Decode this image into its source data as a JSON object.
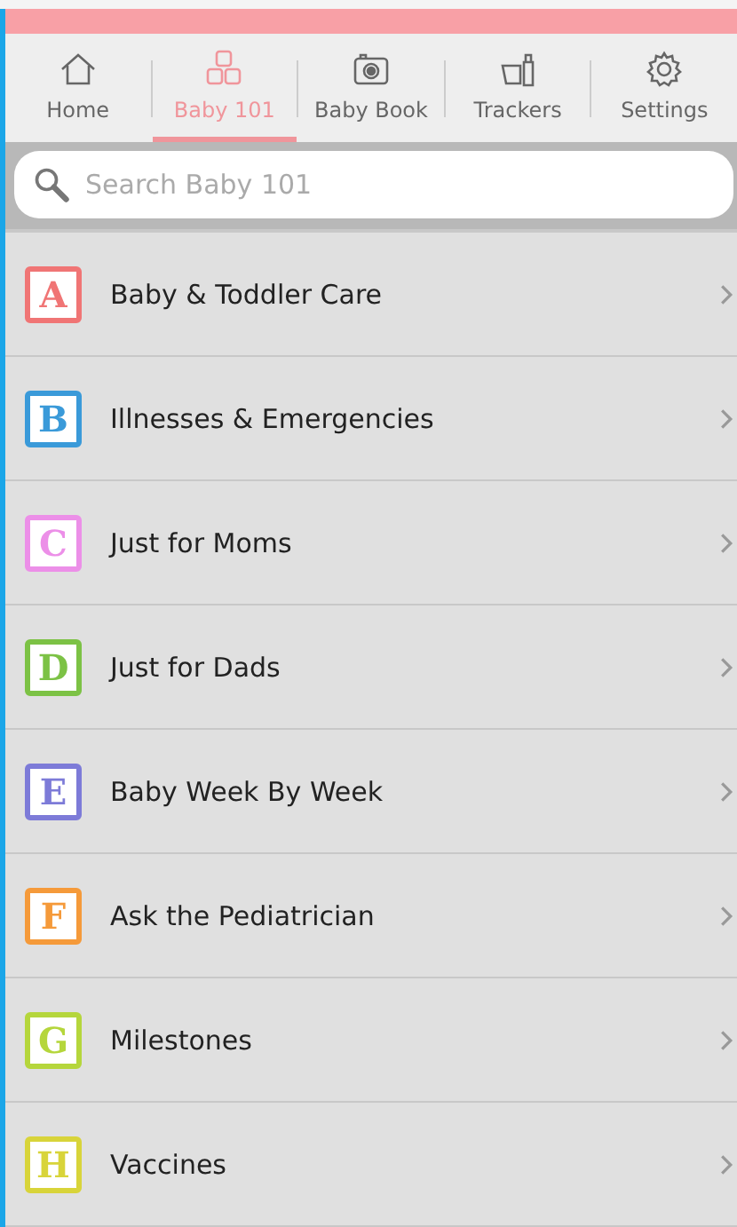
{
  "tabs": [
    {
      "label": "Home",
      "kind": "home",
      "selected": false
    },
    {
      "label": "Baby 101",
      "kind": "blocks",
      "selected": true
    },
    {
      "label": "Baby Book",
      "kind": "camera",
      "selected": false
    },
    {
      "label": "Trackers",
      "kind": "bottle",
      "selected": false
    },
    {
      "label": "Settings",
      "kind": "gear",
      "selected": false
    }
  ],
  "search": {
    "placeholder": "Search Baby 101"
  },
  "items": [
    {
      "letter": "A",
      "label": "Baby & Toddler Care",
      "color": "#f07575"
    },
    {
      "letter": "B",
      "label": "Illnesses & Emergencies",
      "color": "#3a9ad9"
    },
    {
      "letter": "C",
      "label": "Just for Moms",
      "color": "#ec8fe8"
    },
    {
      "letter": "D",
      "label": "Just for Dads",
      "color": "#7cc245"
    },
    {
      "letter": "E",
      "label": "Baby Week By Week",
      "color": "#7d7bd8"
    },
    {
      "letter": "F",
      "label": "Ask the Pediatrician",
      "color": "#f59a3a"
    },
    {
      "letter": "G",
      "label": "Milestones",
      "color": "#b5d63c"
    },
    {
      "letter": "H",
      "label": "Vaccines",
      "color": "#d8d43a"
    }
  ]
}
